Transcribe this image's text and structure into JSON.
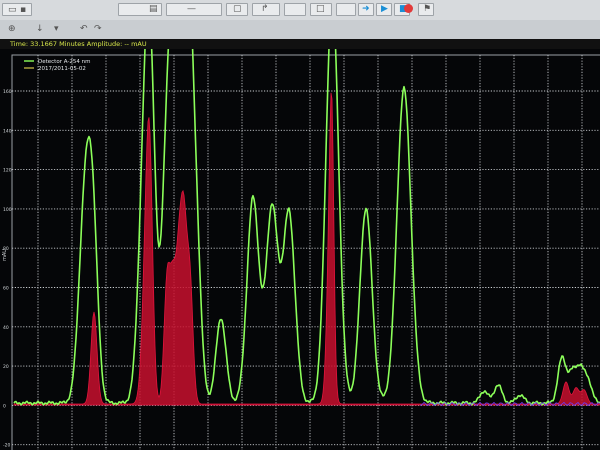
{
  "status": {
    "text": "Time: 33.1667 Minutes  Amplitude: -- mAU"
  },
  "legend": {
    "series_label": "Detector A-254 nm",
    "date_label": "2017/2011-05-02"
  },
  "y_axis": {
    "unit": "mAU",
    "ticks": [
      "160",
      "140",
      "120",
      "100",
      "80",
      "60",
      "40",
      "20",
      "0",
      "-20"
    ]
  },
  "colors": {
    "background": "#050608",
    "grid": "#c9ccd0",
    "trace_primary": "#8cff5a",
    "trace_secondary": "#d0103a",
    "baseline_accent": "#6c3cff",
    "status_text": "#d7e64a"
  },
  "toolbar": {
    "record_icon": "record-icon",
    "play_icon": "play-icon",
    "stop_icon": "stop-icon",
    "folder_icon": "folder-icon",
    "save_icon": "save-icon"
  }
}
